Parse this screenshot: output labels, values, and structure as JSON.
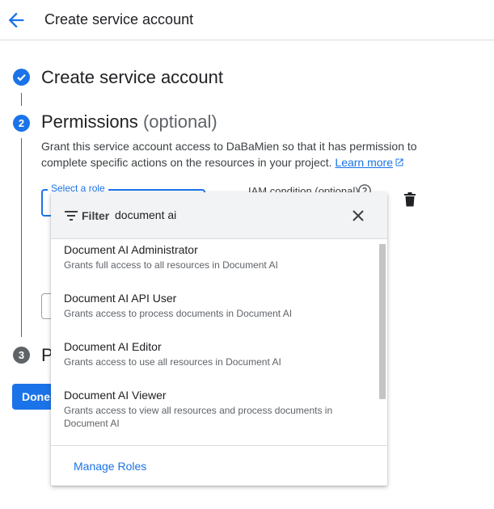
{
  "header": {
    "title": "Create service account",
    "back_icon": "arrow-back-icon"
  },
  "steps": [
    {
      "number": "✓",
      "title": "Create service account",
      "status": "complete"
    },
    {
      "number": "2",
      "title": "Permissions",
      "optional": "(optional)",
      "status": "active"
    },
    {
      "number": "3",
      "title": "P",
      "status": "pending"
    }
  ],
  "permissions": {
    "description_part1": "Grant this service account access to DaBaMien so that it has permission to complete specific actions on the resources in your project.",
    "learn_more": "Learn more",
    "role_label": "Select a role",
    "iam_condition_label": "IAM condition (optional)"
  },
  "done_button": "Done",
  "dropdown": {
    "filter_label": "Filter",
    "filter_value": "document ai",
    "options": [
      {
        "title": "Document AI Administrator",
        "description": "Grants full access to all resources in Document AI"
      },
      {
        "title": "Document AI API User",
        "description": "Grants access to process documents in Document AI"
      },
      {
        "title": "Document AI Editor",
        "description": "Grants access to use all resources in Document AI"
      },
      {
        "title": "Document AI Viewer",
        "description": "Grants access to view all resources and process documents in Document AI"
      }
    ],
    "footer_link": "Manage Roles"
  },
  "colors": {
    "accent": "#1a73e8",
    "pending_step": "#5f6368",
    "filter_background": "#f1f3f4"
  }
}
